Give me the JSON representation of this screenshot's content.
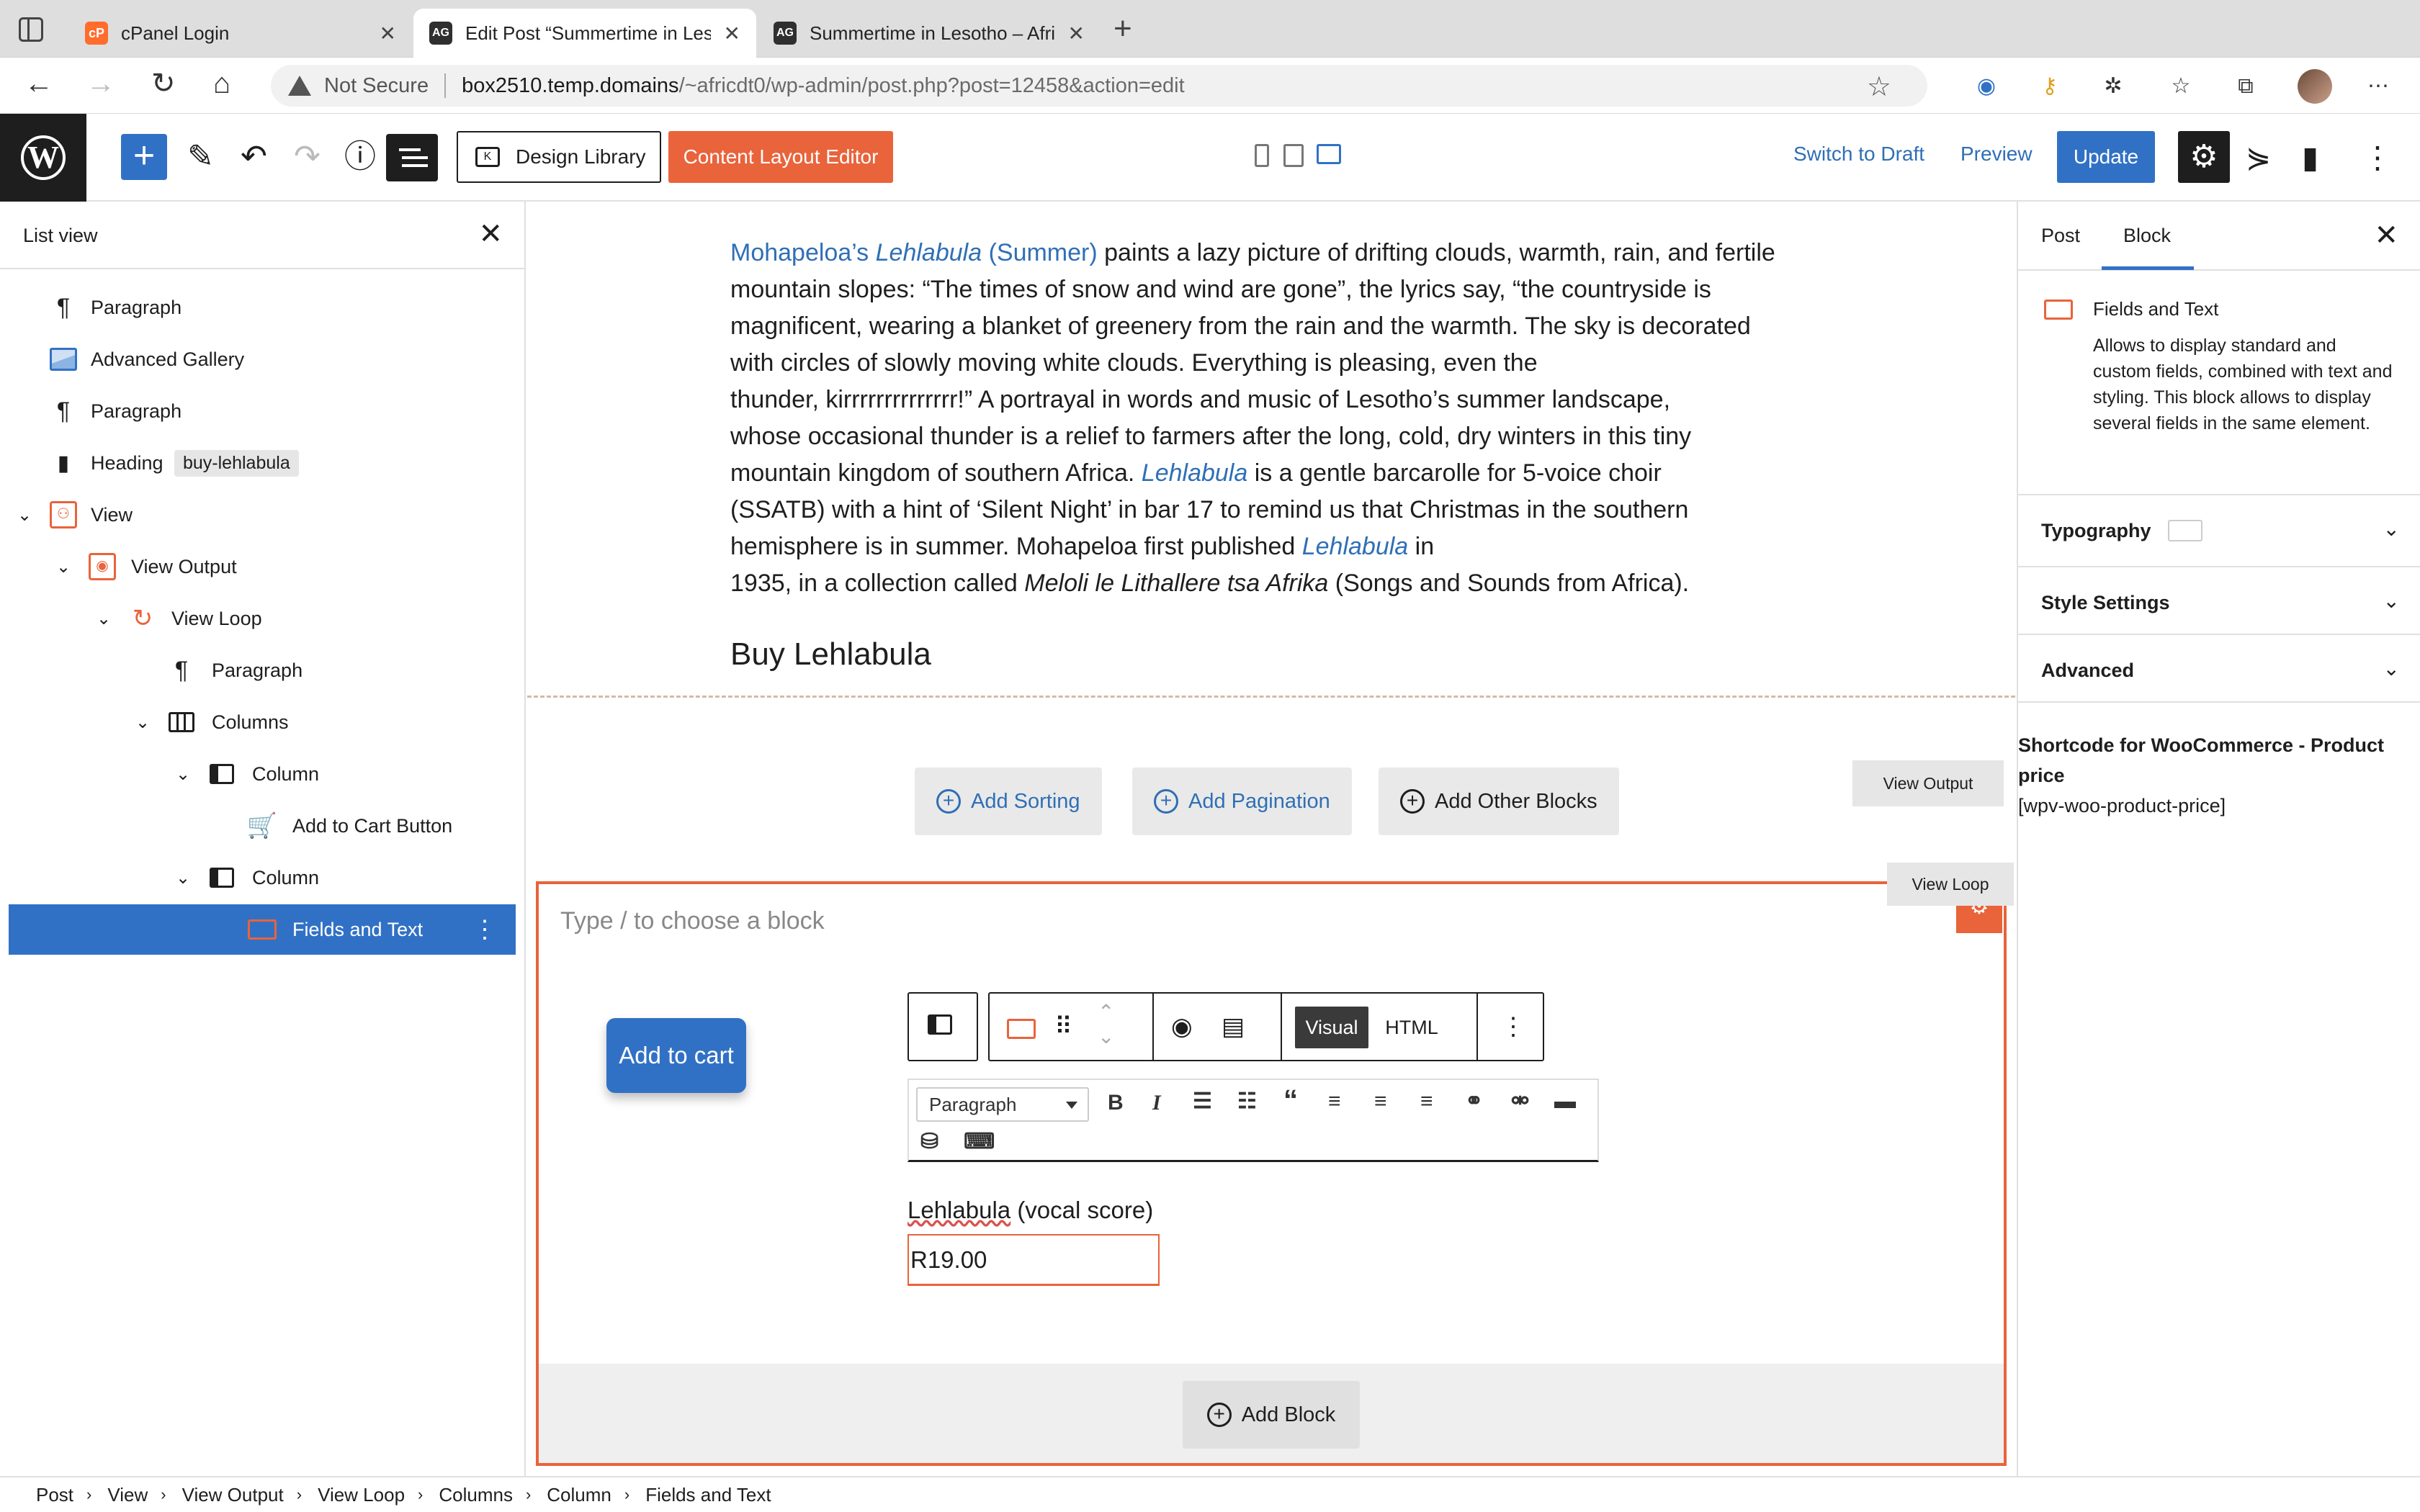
{
  "browser": {
    "tabs": [
      {
        "label": "cPanel Login",
        "favicon": "cpanel-icon"
      },
      {
        "label": "Edit Post “Summertime in Lesotho",
        "favicon": "ag-icon"
      },
      {
        "label": "Summertime in Lesotho – Africa",
        "favicon": "ag-icon"
      }
    ],
    "security": "Not Secure",
    "url_host": "box2510.temp.domains",
    "url_path": "/~africdt0/wp-admin/post.php?post=12458&action=edit"
  },
  "toolbar": {
    "design_library": "Design Library",
    "content_layout_editor": "Content Layout Editor",
    "switch_to_draft": "Switch to Draft",
    "preview": "Preview",
    "update": "Update"
  },
  "list_view": {
    "title": "List view",
    "items": [
      {
        "label": "Paragraph",
        "icon": "paragraph-icon"
      },
      {
        "label": "Advanced Gallery",
        "icon": "gallery-icon"
      },
      {
        "label": "Paragraph",
        "icon": "paragraph-icon"
      },
      {
        "label": "Heading",
        "icon": "bookmark-icon",
        "anchor": "buy-lehlabula"
      },
      {
        "label": "View",
        "icon": "view-icon"
      },
      {
        "label": "View Output",
        "icon": "view-output-icon"
      },
      {
        "label": "View Loop",
        "icon": "view-loop-icon"
      },
      {
        "label": "Paragraph",
        "icon": "paragraph-icon"
      },
      {
        "label": "Columns",
        "icon": "columns-icon"
      },
      {
        "label": "Column",
        "icon": "column-icon"
      },
      {
        "label": "Add to Cart Button",
        "icon": "cart-icon"
      },
      {
        "label": "Column",
        "icon": "column-icon"
      },
      {
        "label": "Fields and Text",
        "icon": "fields-text-icon"
      }
    ]
  },
  "content": {
    "para": {
      "l1_link1": "Mohapeloa’s",
      "l1_link2": "Lehlabula",
      "l1_link3": "(Summer)",
      "l1_rest": "paints a lazy picture of drifting clouds, warmth, rain, and fertile",
      "l2": "mountain slopes: “The times of snow and wind are gone”, the lyrics say, “the countryside is",
      "l3": "magnificent, wearing a blanket of greenery from the rain and the warmth. The sky is decorated",
      "l4": "with circles of slowly moving white clouds. Everything is pleasing, even the",
      "l5": "thunder, kirrrrrrrrrrrrrr!” A portrayal in words and music of Lesotho’s summer landscape,",
      "l6": "whose occasional thunder is a relief to farmers after the long, cold, dry winters in this tiny",
      "l7a": "mountain kingdom of southern Africa.",
      "l7_link": "Lehlabula",
      "l7b": "is a gentle barcarolle for 5-voice choir",
      "l8": "(SSATB) with a hint of ‘Silent Night’ in bar 17 to remind us that Christmas in the southern",
      "l9a": "hemisphere is in summer. Mohapeloa first published",
      "l9_link": "Lehlabula",
      "l9b": "in",
      "l10a": "1935, in a collection called",
      "l10_it": "Meloli le Lithallere tsa Afrika",
      "l10b": "(Songs and Sounds from Africa)."
    },
    "heading": "Buy Lehlabula",
    "view_buttons": {
      "add_sorting": "Add Sorting",
      "add_pagination": "Add Pagination",
      "add_other_blocks": "Add Other Blocks"
    },
    "view_output_label": "View Output",
    "view_loop_label": "View Loop",
    "placeholder": "Type / to choose a block",
    "add_to_cart": "Add to cart",
    "block_toolbar": {
      "visual": "Visual",
      "html": "HTML"
    },
    "format_select": "Paragraph",
    "field_label": "Lehlabula",
    "field_label_rest": "(vocal score)",
    "price": "R19.00",
    "add_block": "Add Block"
  },
  "sidebar": {
    "tabs": [
      "Post",
      "Block"
    ],
    "active_tab": "Block",
    "block_title": "Fields and Text",
    "block_desc": "Allows to display standard and custom fields, combined with text and styling. This block allows to display several fields in the same element.",
    "panels": [
      "Typography",
      "Style Settings",
      "Advanced"
    ],
    "shortcode_title": "Shortcode for WooCommerce - Product price",
    "shortcode_value": "[wpv-woo-product-price]"
  },
  "breadcrumb": [
    "Post",
    "View",
    "View Output",
    "View Loop",
    "Columns",
    "Column",
    "Fields and Text"
  ],
  "colors": {
    "accent_blue": "#3171c5",
    "accent_orange": "#e9633b",
    "link_blue": "#2f6fb5"
  }
}
